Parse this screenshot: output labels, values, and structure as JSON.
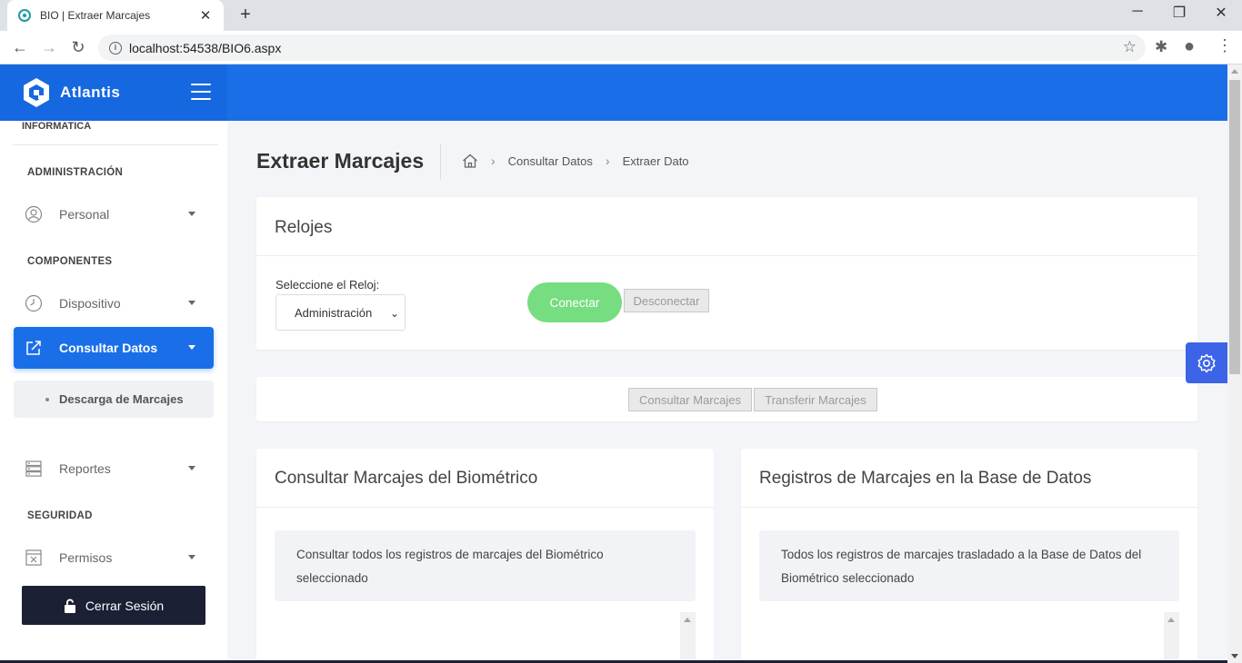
{
  "browser": {
    "tab_title": "BIO | Extraer Marcajes",
    "tab_close": "✕",
    "new_tab": "+",
    "url": "localhost:54538/BIO6.aspx",
    "controls": {
      "minimize": "─",
      "restore": "❐",
      "close": "✕"
    },
    "nav": {
      "back": "←",
      "forward": "→",
      "reload": "↻"
    },
    "icons": {
      "star": "☆",
      "extension": "✱",
      "account": "●",
      "menu": "⋮"
    }
  },
  "header": {
    "brand": "Atlantis",
    "brand_color": "#1a6fe8"
  },
  "sidebar": {
    "cut_section": "INFORMATICA",
    "sections": {
      "admin": "ADMINISTRACIÓN",
      "components": "COMPONENTES",
      "security": "SEGURIDAD"
    },
    "items": {
      "personal": "Personal",
      "dispositivo": "Dispositivo",
      "consultar": "Consultar Datos",
      "descarga": "Descarga de Marcajes",
      "reportes": "Reportes",
      "permisos": "Permisos"
    },
    "logout": "Cerrar Sesión"
  },
  "page": {
    "title": "Extraer Marcajes",
    "breadcrumb": [
      "Consultar Datos",
      "Extraer Dato"
    ]
  },
  "relojes": {
    "title": "Relojes",
    "select_label": "Seleccione el Reloj:",
    "select_value": "Administración",
    "connect": "Conectar",
    "disconnect": "Desconectar"
  },
  "actions": {
    "consultar": "Consultar Marcajes",
    "transferir": "Transferir Marcajes"
  },
  "panels": [
    {
      "title": "Consultar Marcajes del Biométrico",
      "text": "Consultar todos los registros de marcajes del Biométrico seleccionado"
    },
    {
      "title": "Registros de Marcajes en la Base de Datos",
      "text": "Todos los registros de marcajes trasladado a la Base de Datos del Biométrico seleccionado"
    }
  ]
}
